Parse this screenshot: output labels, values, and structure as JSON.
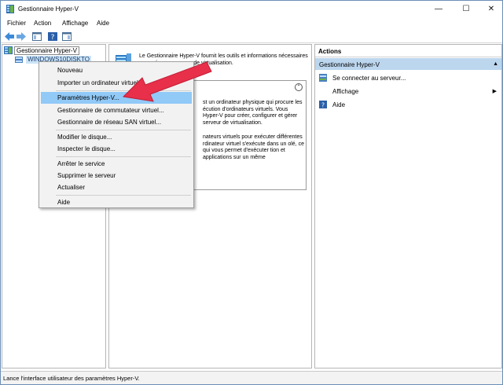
{
  "window": {
    "title": "Gestionnaire Hyper-V",
    "controls": {
      "minimize": "—",
      "maximize": "☐",
      "close": "✕"
    }
  },
  "menu": [
    "Fichier",
    "Action",
    "Affichage",
    "Aide"
  ],
  "toolbar": [
    "back-icon",
    "forward-icon",
    "console-tree-icon",
    "help-icon",
    "action-pane-icon"
  ],
  "tree": {
    "root": "Gestionnaire Hyper-V",
    "server": "WINDOWS10DISKTO"
  },
  "center": {
    "intro": "Le Gestionnaire Hyper-V fournit les outils et informations nécessaires pour gérer un serveur de virtualisation.",
    "para1": "st un ordinateur physique qui procure les écution d'ordinateurs virtuels. Vous Hyper-V pour créer, configurer et gérer serveur de virtualisation.",
    "para2": "nateurs virtuels pour exécuter différentes rdinateur virtuel s'exécute dans un olé, ce qui vous permet d'exécuter tion et applications sur un même",
    "collapse": "⌃"
  },
  "actions": {
    "title": "Actions",
    "section": "Gestionnaire Hyper-V",
    "items": [
      {
        "label": "Se connecter au serveur...",
        "icon": "server-connect-icon"
      },
      {
        "label": "Affichage",
        "icon": "",
        "submenu": true
      },
      {
        "label": "Aide",
        "icon": "help-icon"
      }
    ]
  },
  "context_menu": {
    "items": [
      "Nouveau",
      "Importer un ordinateur virtuel...",
      "Paramètres Hyper-V...",
      "Gestionnaire de commutateur virtuel...",
      "Gestionnaire de réseau SAN virtuel...",
      "Modifier le disque...",
      "Inspecter le disque...",
      "Arrêter le service",
      "Supprimer le serveur",
      "Actualiser",
      "Aide"
    ],
    "highlighted": "Paramètres Hyper-V..."
  },
  "status": "Lance l'interface utilisateur des paramètres Hyper-V.",
  "colors": {
    "highlight": "#91c9f7",
    "section": "#bcd6ee",
    "arrow": "#e8304a"
  }
}
